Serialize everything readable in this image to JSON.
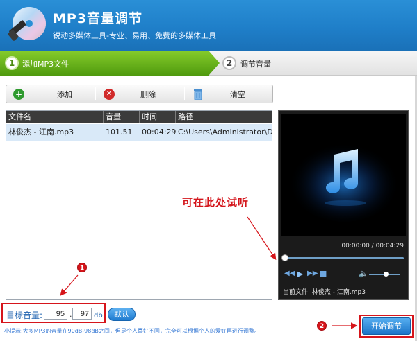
{
  "header": {
    "title": "MP3音量调节",
    "subtitle": "锐动多媒体工具-专业、易用、免费的多媒体工具"
  },
  "steps": [
    {
      "num": "1",
      "label": "添加MP3文件",
      "active": true
    },
    {
      "num": "2",
      "label": "调节音量",
      "active": false
    }
  ],
  "toolbar": {
    "add_label": "添加",
    "delete_label": "删除",
    "clear_label": "清空"
  },
  "table": {
    "columns": [
      "文件名",
      "音量",
      "时间",
      "路径"
    ],
    "rows": [
      {
        "name": "林俊杰 - 江南.mp3",
        "volume": "101.51",
        "time": "00:04:29",
        "path": "C:\\Users\\Administrator\\D..."
      }
    ]
  },
  "player": {
    "time_readout": "00:00:00 / 00:04:29",
    "progress": 0,
    "volume_level": 0.55,
    "current_file": "当前文件: 林俊杰 - 江南.mp3"
  },
  "annotation": {
    "text": "可在此处试听",
    "badge1": "1",
    "badge2": "2"
  },
  "volume_target": {
    "label": "目标音量:",
    "integer_value": "95",
    "separator": ".",
    "decimal_value": "97",
    "unit": "db",
    "default_label": "默认"
  },
  "tip": "小提示:大多MP3的音量在90dB-98dB之间，但是个人喜好不同，完全可以根据个人的爱好再进行调整。",
  "start_button_label": "开始调节",
  "colors": {
    "header_blue": "#1f7fc9",
    "step_green": "#5fae16",
    "annotation_red": "#d6151b"
  },
  "icons": {
    "logo": "speaker-cd-logo-icon",
    "add": "plus-circle-icon",
    "delete": "x-circle-icon",
    "clear": "trash-icon",
    "media": "music-note-icon"
  }
}
